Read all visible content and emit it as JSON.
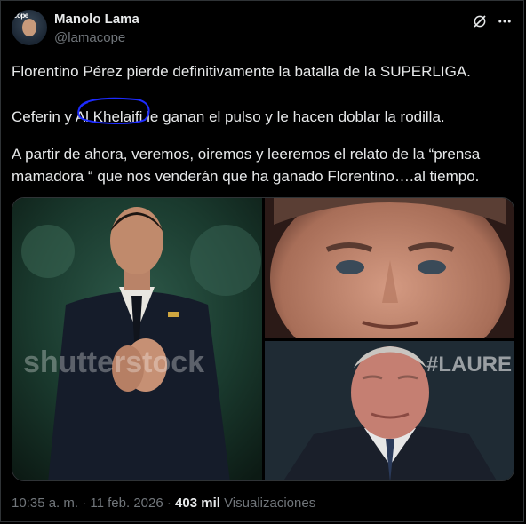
{
  "author": {
    "name": "Manolo Lama",
    "handle": "@lamacope",
    "avatar_badge": "cope"
  },
  "tweet": {
    "paragraph1": "Florentino Pérez pierde definitivamente la batalla de la SUPERLIGA.",
    "paragraph2": "Ceferin y Al Khelaifi le ganan el pulso y le hacen doblar la rodilla.",
    "paragraph3": "A partir de ahora, veremos, oiremos y leeremos el relato de la “prensa mamadora “ que nos venderán que ha ganado Florentino….al tiempo.",
    "annotation_color": "#1d2bff"
  },
  "media": {
    "watermark": "shutterstock",
    "backdrop_text": "#LAURE"
  },
  "meta": {
    "time": "10:35 a. m.",
    "separator": "·",
    "date": "11 feb. 2026",
    "views_count": "403 mil",
    "views_label": "Visualizaciones"
  },
  "icons": {
    "grok": "grok-icon",
    "more": "more-options-icon"
  },
  "colors": {
    "background": "#000000",
    "text": "#e7e9ea",
    "secondary": "#71767b",
    "border": "#2f3336"
  }
}
